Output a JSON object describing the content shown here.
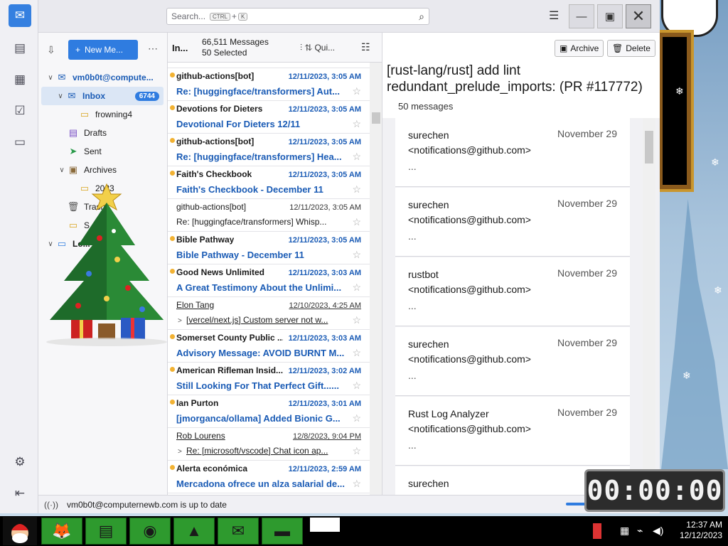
{
  "search": {
    "placeholder": "Search...",
    "key1": "CTRL",
    "plus": "+",
    "key2": "K"
  },
  "folder_pane": {
    "new_message": "New Me...",
    "account": "vm0b0t@compute...",
    "folders": [
      {
        "label": "Inbox",
        "badge": "6744"
      },
      {
        "label": "frowning4"
      },
      {
        "label": "Drafts"
      },
      {
        "label": "Sent"
      },
      {
        "label": "Archives"
      },
      {
        "label": "2023"
      },
      {
        "label": "Trash"
      },
      {
        "label": "S..."
      },
      {
        "label": "Lo..."
      }
    ]
  },
  "list_pane": {
    "folder_short": "In...",
    "messages_count": "66,511 Messages",
    "selected_count": "50 Selected",
    "quick_filter": "Qui...",
    "rows": [
      {
        "from": "github-actions[bot]",
        "date": "12/11/2023, 3:05 AM",
        "subject": "Re: [huggingface/transformers] Aut..."
      },
      {
        "from": "Devotions for Dieters",
        "date": "12/11/2023, 3:05 AM",
        "subject": "Devotional For Dieters 12/11"
      },
      {
        "from": "github-actions[bot]",
        "date": "12/11/2023, 3:05 AM",
        "subject": "Re: [huggingface/transformers] Hea..."
      },
      {
        "from": "Faith's Checkbook",
        "date": "12/11/2023, 3:05 AM",
        "subject": "Faith's Checkbook - December 11"
      },
      {
        "from": "github-actions[bot]",
        "date": "12/11/2023, 3:05 AM",
        "subject": "Re: [huggingface/transformers] Whisp..."
      },
      {
        "from": "Bible Pathway",
        "date": "12/11/2023, 3:05 AM",
        "subject": "Bible Pathway - December 11"
      },
      {
        "from": "Good News Unlimited",
        "date": "12/11/2023, 3:03 AM",
        "subject": "A Great Testimony About the Unlimi..."
      },
      {
        "from": "Elon Tang",
        "date": "12/10/2023, 4:25 AM",
        "subject": "[vercel/next.js] Custom server not w..."
      },
      {
        "from": "Somerset County Public ...",
        "date": "12/11/2023, 3:03 AM",
        "subject": "Advisory Message: AVOID BURNT M..."
      },
      {
        "from": "American Rifleman Insid...",
        "date": "12/11/2023, 3:02 AM",
        "subject": "Still Looking For That Perfect Gift......"
      },
      {
        "from": "Ian Purton",
        "date": "12/11/2023, 3:01 AM",
        "subject": "[jmorganca/ollama] Added Bionic G..."
      },
      {
        "from": "Rob Lourens",
        "date": "12/8/2023, 9:04 PM",
        "subject": "Re: [microsoft/vscode] Chat icon ap..."
      },
      {
        "from": "Alerta económica",
        "date": "12/11/2023, 2:59 AM",
        "subject": "Mercadona ofrece un alza salarial de..."
      }
    ]
  },
  "reading_pane": {
    "archive": "Archive",
    "delete": "Delete",
    "title": "[rust-lang/rust] add lint redundant_prelude_imports: (PR #117772)",
    "count": "50 messages",
    "cards": [
      {
        "name": "surechen",
        "email": "<notifications@github.com>",
        "date": "November 29",
        "snippet": "..."
      },
      {
        "name": "surechen",
        "email": "<notifications@github.com>",
        "date": "November 29",
        "snippet": "..."
      },
      {
        "name": "rustbot",
        "email": "<notifications@github.com>",
        "date": "November 29",
        "snippet": "..."
      },
      {
        "name": "surechen",
        "email": "<notifications@github.com>",
        "date": "November 29",
        "snippet": "..."
      },
      {
        "name": "Rust Log Analyzer",
        "email": "<notifications@github.com>",
        "date": "November 29",
        "snippet": "..."
      },
      {
        "name": "surechen",
        "email": "",
        "date": "Novem",
        "snippet": ""
      }
    ]
  },
  "status": {
    "text": "vm0b0t@computernewb.com is up to date"
  },
  "clock": {
    "display": "00:00:00"
  },
  "taskbar": {
    "time": "12:37 AM",
    "date": "12/12/2023"
  },
  "colors": {
    "accent": "#2f7ce0",
    "unread_blue": "#1a5bb5",
    "unread_dot": "#f2b233",
    "taskbar_green": "#2e9a2e"
  }
}
